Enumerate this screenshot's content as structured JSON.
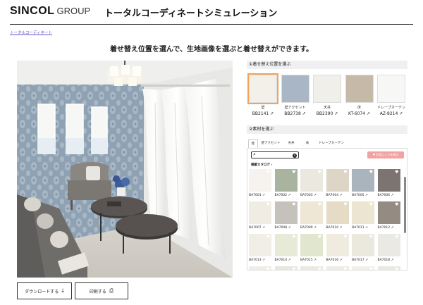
{
  "header": {
    "logo_main": "SINCOL",
    "logo_sub": "GROUP",
    "title": "トータルコーディネートシミュレーション"
  },
  "breadcrumb": "トータルコーディネート",
  "headline": "着せ替え位置を選んで、生地画像を選ぶと着せ替えができます。",
  "actions": {
    "download": {
      "label": "ダウンロードする",
      "icon": "download-icon"
    },
    "print": {
      "label": "印刷する",
      "icon": "print-icon"
    }
  },
  "positions_title": "①着せ替え位置を選ぶ",
  "positions": [
    {
      "name": "壁",
      "code": "BB2141",
      "color": "#f3f0ea",
      "selected": true
    },
    {
      "name": "壁アクセント",
      "code": "BB2738",
      "color": "#a9b6c6"
    },
    {
      "name": "天井",
      "code": "BB2390",
      "color": "#f1efea"
    },
    {
      "name": "床",
      "code": "KT-6074",
      "color": "#c7b9a8"
    },
    {
      "name": "ドレープカーテン",
      "code": "AZ-8214",
      "color": "#f7f7f5"
    }
  ],
  "materials_title": "②素材を選ぶ",
  "tabs": [
    "壁",
    "壁アクセント",
    "天井",
    "床",
    "ドレープカーテン"
  ],
  "favorites_label": "♥ お気に入りを表示",
  "catalog_label": "掲載カタログ",
  "materials": [
    {
      "code": "BA7001",
      "color": "#f6f3ee"
    },
    {
      "code": "BA7002",
      "color": "#a8b3a0"
    },
    {
      "code": "BA7003",
      "color": "#ebe8e0"
    },
    {
      "code": "BA7004",
      "color": "#ddd6c6"
    },
    {
      "code": "BA7005",
      "color": "#a9b4bd"
    },
    {
      "code": "BA7006",
      "color": "#7c7470"
    },
    {
      "code": "BA7007",
      "color": "#f0ece4"
    },
    {
      "code": "BA7008",
      "color": "#c5c2bc"
    },
    {
      "code": "BA7009",
      "color": "#efe7d6"
    },
    {
      "code": "BA7010",
      "color": "#e6dcc6"
    },
    {
      "code": "BA7011",
      "color": "#ebe5d2"
    },
    {
      "code": "BA7012",
      "color": "#948b83"
    },
    {
      "code": "BA7013",
      "color": "#f1eee7"
    },
    {
      "code": "BA7014",
      "color": "#e8ead8"
    },
    {
      "code": "BA7015",
      "color": "#e1e7cf"
    },
    {
      "code": "BA7016",
      "color": "#f0ebdf"
    },
    {
      "code": "BA7017",
      "color": "#ebe8de"
    },
    {
      "code": "BA7018",
      "color": "#ebe9e4"
    },
    {
      "color": "#f0ede6"
    },
    {
      "color": "#e9e7dd"
    },
    {
      "color": "#ece9e0"
    },
    {
      "color": "#efece4"
    },
    {
      "color": "#f1efe8"
    },
    {
      "color": "#eae8e2"
    }
  ],
  "colors": {
    "accent": "#f2a25c",
    "favorite": "#f2a2a2",
    "link": "#5a4fc4"
  }
}
